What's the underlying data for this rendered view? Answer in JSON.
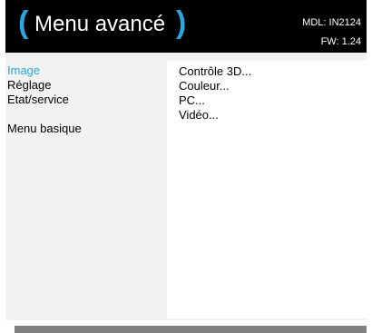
{
  "header": {
    "paren_open": "(",
    "title": "Menu avancé",
    "paren_close": ")",
    "model": "MDL: IN2124",
    "firmware": "FW: 1.24"
  },
  "left_menu": {
    "items": [
      {
        "label": "Image",
        "active": true
      },
      {
        "label": "Réglage",
        "active": false
      },
      {
        "label": "Etat/service",
        "active": false
      }
    ],
    "basic_menu_label": "Menu basique"
  },
  "submenu": {
    "items": [
      {
        "label": "Contrôle 3D..."
      },
      {
        "label": "Couleur..."
      },
      {
        "label": "PC..."
      },
      {
        "label": "Vidéo..."
      }
    ]
  },
  "colors": {
    "accent": "#2aa6e0",
    "header_bg": "#000000",
    "body_bg": "#f2f2f2",
    "panel_bg": "#ffffff",
    "bar": "#808080"
  }
}
